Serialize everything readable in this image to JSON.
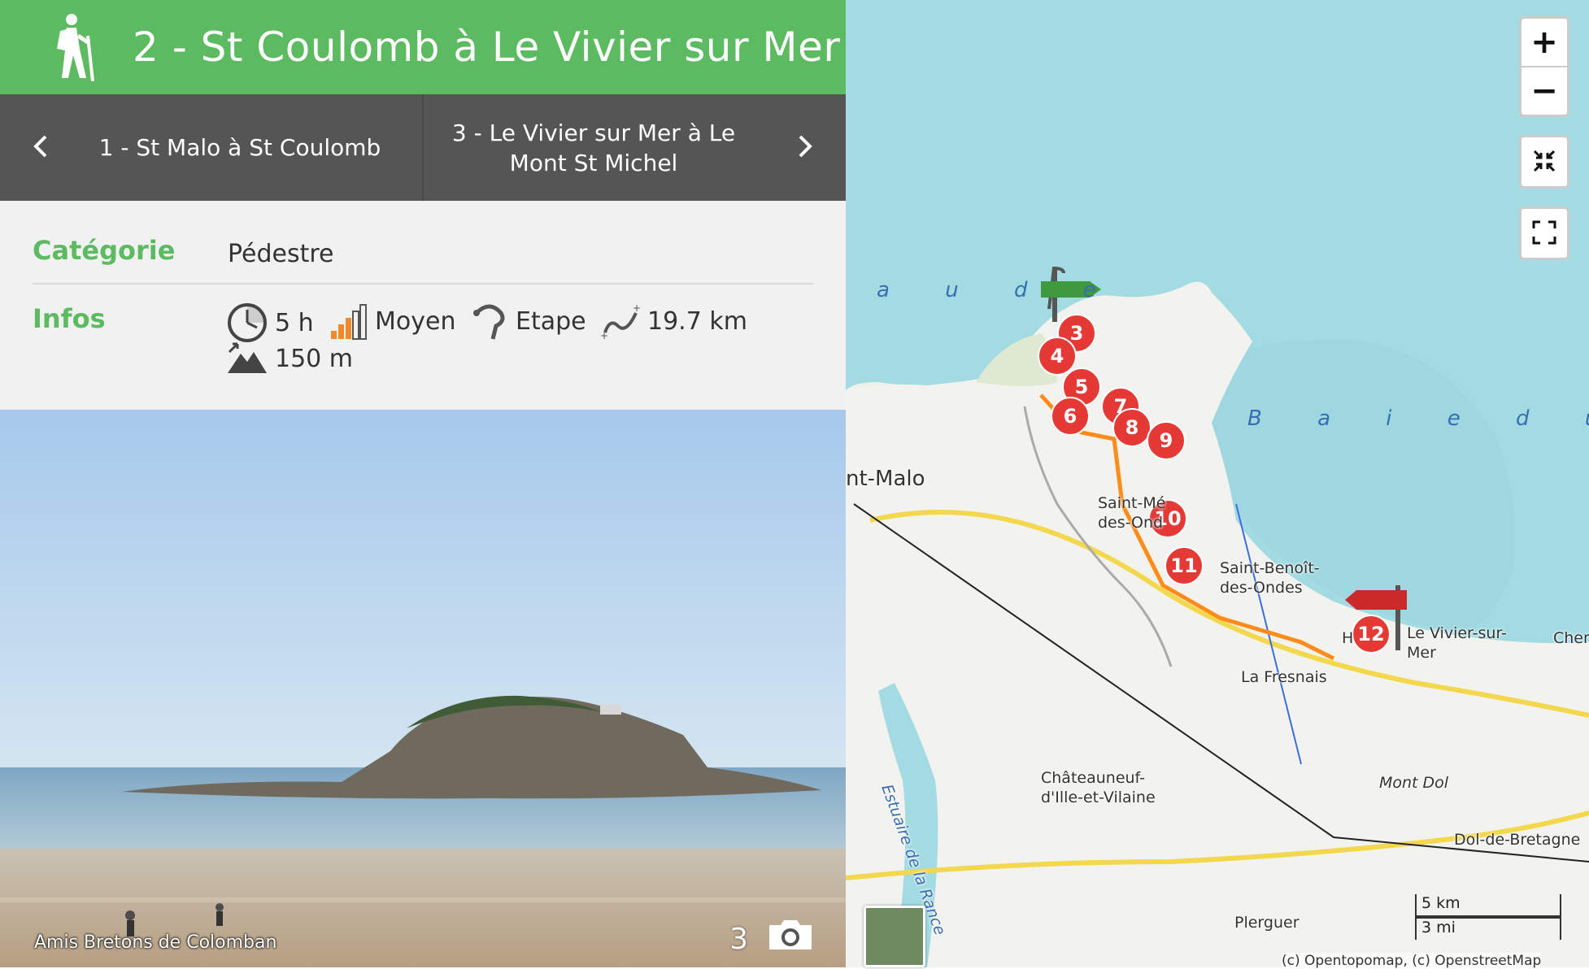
{
  "header": {
    "title": "2 - St Coulomb à Le Vivier sur Mer",
    "icon": "hiker-icon",
    "color": "#5cbb61"
  },
  "nav": {
    "prev_label": "1 - St Malo à St Coulomb",
    "next_label": "3 - Le Vivier sur Mer à Le Mont St Michel"
  },
  "info": {
    "category_label": "Catégorie",
    "category_value": "Pédestre",
    "infos_label": "Infos",
    "duration": "5 h",
    "difficulty": "Moyen",
    "type": "Etape",
    "distance": "19.7 km",
    "elevation": "150 m"
  },
  "photo": {
    "credit": "Amis Bretons de Colomban",
    "count": "3"
  },
  "map": {
    "zoom_in": "+",
    "zoom_out": "−",
    "markers": [
      "3",
      "4",
      "5",
      "6",
      "7",
      "8",
      "9",
      "10",
      "11",
      "12"
    ],
    "places": {
      "st_malo": "nt-Malo",
      "st_meloir_1": "Saint-Mé",
      "st_meloir_2": "des-Ond",
      "st_benoit_1": "Saint-Benoît-",
      "st_benoit_2": "des-Ondes",
      "le_vivier_1": "Le Vivier-sur-",
      "le_vivier_2": "Mer",
      "h": "H",
      "la_fresnais": "La Fresnais",
      "chateauneuf_1": "Châteauneuf-",
      "chateauneuf_2": "d'Ille-et-Vilaine",
      "mont_dol": "Mont Dol",
      "dol": "Dol-de-Bretagne",
      "pleurguer": "Plerguer",
      "cher": "Cher",
      "estuaire": "Estuaire de la Rance"
    },
    "sea_label_1": "a u d e",
    "sea_label_2": "B a i e   d u   M",
    "scale_km": "5 km",
    "scale_mi": "3 mi",
    "attribution": "(c) Opentopomap, (c) OpenstreetMap"
  },
  "colors": {
    "accent": "#5cbb61",
    "nav_bg": "#555555",
    "marker": "#e53935",
    "route": "#ff8c1a",
    "sea": "#a3dbe3"
  }
}
